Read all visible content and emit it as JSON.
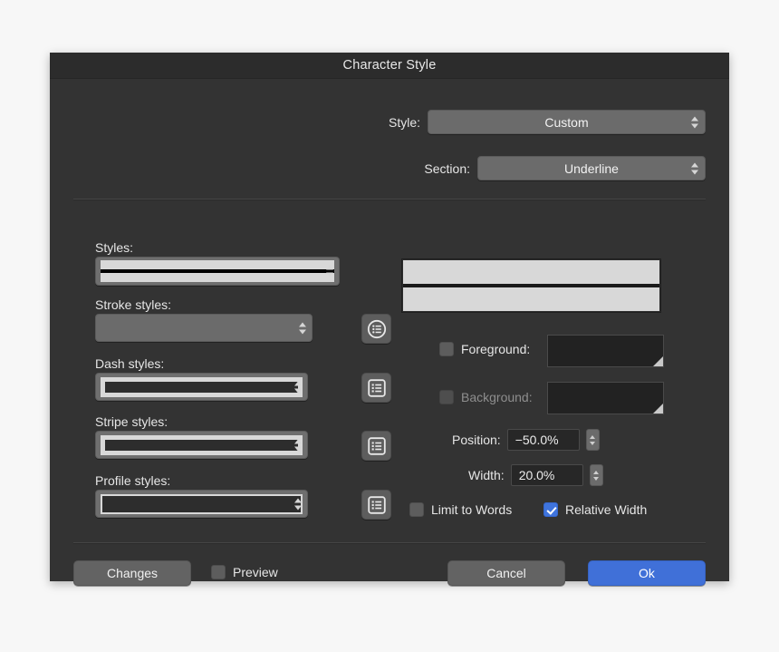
{
  "window": {
    "title": "Character Style"
  },
  "header": {
    "style_label": "Style:",
    "style_value": "Custom",
    "section_label": "Section:",
    "section_value": "Underline"
  },
  "left_panel": {
    "fields": [
      {
        "label": "Styles:",
        "value": "",
        "swatch": "solid-underline",
        "has_list_button": false,
        "enabled": true
      },
      {
        "label": "Stroke styles:",
        "value": "",
        "swatch": "none",
        "has_list_button": true,
        "list_icon": "list-circle-icon",
        "enabled": false
      },
      {
        "label": "Dash styles:",
        "value": "",
        "swatch": "dash-pattern",
        "has_list_button": true,
        "list_icon": "list-square-icon",
        "enabled": true
      },
      {
        "label": "Stripe styles:",
        "value": "",
        "swatch": "stripe-pattern",
        "has_list_button": true,
        "list_icon": "list-square-icon",
        "enabled": true
      },
      {
        "label": "Profile styles:",
        "value": "",
        "swatch": "profile-pattern",
        "has_list_button": true,
        "list_icon": "list-square-icon",
        "enabled": true
      }
    ]
  },
  "right_panel": {
    "preview": {
      "band_color": "#d8d8d8",
      "gap_color": "#1a1a1a"
    },
    "foreground": {
      "label": "Foreground:",
      "checked": false,
      "enabled": true,
      "color": "#222222"
    },
    "background": {
      "label": "Background:",
      "checked": false,
      "enabled": false,
      "color": "#222222"
    },
    "position": {
      "label": "Position:",
      "value": "−50.0%"
    },
    "width": {
      "label": "Width:",
      "value": "20.0%"
    },
    "limit_to_words": {
      "label": "Limit to Words",
      "checked": false
    },
    "relative_width": {
      "label": "Relative Width",
      "checked": true
    }
  },
  "footer": {
    "changes_label": "Changes",
    "preview_label": "Preview",
    "preview_checked": false,
    "cancel_label": "Cancel",
    "ok_label": "Ok"
  },
  "colors": {
    "dialog_bg": "#333333",
    "titlebar_bg": "#2c2c2c",
    "accent_blue": "#4070d8",
    "control_gray": "#6b6b6b",
    "text": "#e6e6e6",
    "text_disabled": "#8e8e8e"
  }
}
